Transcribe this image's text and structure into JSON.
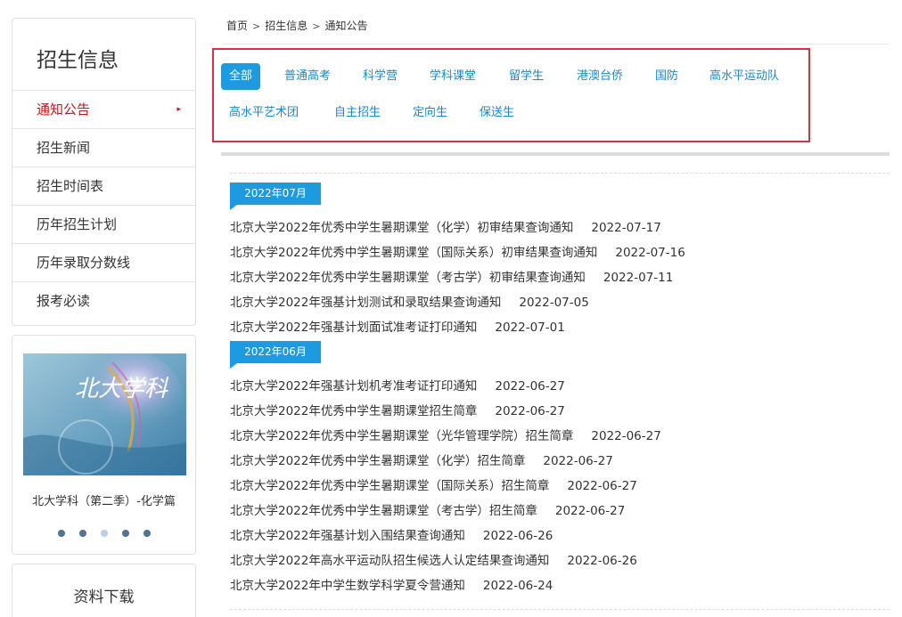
{
  "sidebar": {
    "title": "招生信息",
    "items": [
      {
        "label": "通知公告",
        "active": true
      },
      {
        "label": "招生新闻"
      },
      {
        "label": "招生时间表"
      },
      {
        "label": "历年招生计划"
      },
      {
        "label": "历年录取分数线"
      },
      {
        "label": "报考必读"
      }
    ],
    "caret": "▸"
  },
  "promo": {
    "caption": "北大学科（第二季）-化学篇",
    "image_text": "北大学科",
    "slide_count": 5,
    "active_slide": 2
  },
  "download": {
    "title": "资料下载"
  },
  "breadcrumb": {
    "items": [
      "首页",
      "招生信息",
      "通知公告"
    ],
    "separator": ">"
  },
  "filters": [
    {
      "label": "全部",
      "active": true
    },
    {
      "label": "普通高考"
    },
    {
      "label": "科学营"
    },
    {
      "label": "学科课堂"
    },
    {
      "label": "留学生"
    },
    {
      "label": "港澳台侨"
    },
    {
      "label": "国防"
    },
    {
      "label": "高水平运动队"
    },
    {
      "label": "高水平艺术团"
    },
    {
      "label": "自主招生"
    },
    {
      "label": "定向生"
    },
    {
      "label": "保送生"
    }
  ],
  "groups": [
    {
      "month": "2022年07月",
      "items": [
        {
          "title": "北京大学2022年优秀中学生暑期课堂（化学）初审结果查询通知",
          "date": "2022-07-17"
        },
        {
          "title": "北京大学2022年优秀中学生暑期课堂（国际关系）初审结果查询通知",
          "date": "2022-07-16"
        },
        {
          "title": "北京大学2022年优秀中学生暑期课堂（考古学）初审结果查询通知",
          "date": "2022-07-11"
        },
        {
          "title": "北京大学2022年强基计划测试和录取结果查询通知",
          "date": "2022-07-05"
        },
        {
          "title": "北京大学2022年强基计划面试准考证打印通知",
          "date": "2022-07-01"
        }
      ]
    },
    {
      "month": "2022年06月",
      "items": [
        {
          "title": "北京大学2022年强基计划机考准考证打印通知",
          "date": "2022-06-27"
        },
        {
          "title": "北京大学2022年优秀中学生暑期课堂招生简章",
          "date": "2022-06-27"
        },
        {
          "title": "北京大学2022年优秀中学生暑期课堂（光华管理学院）招生简章",
          "date": "2022-06-27"
        },
        {
          "title": "北京大学2022年优秀中学生暑期课堂（化学）招生简章",
          "date": "2022-06-27"
        },
        {
          "title": "北京大学2022年优秀中学生暑期课堂（国际关系）招生简章",
          "date": "2022-06-27"
        },
        {
          "title": "北京大学2022年优秀中学生暑期课堂（考古学）招生简章",
          "date": "2022-06-27"
        },
        {
          "title": "北京大学2022年强基计划入围结果查询通知",
          "date": "2022-06-26"
        },
        {
          "title": "北京大学2022年高水平运动队招生候选人认定结果查询通知",
          "date": "2022-06-26"
        },
        {
          "title": "北京大学2022年中学生数学科学夏令营通知",
          "date": "2022-06-24"
        }
      ]
    }
  ],
  "colors": {
    "accent": "#1e9ae0",
    "link": "#1a88c9",
    "active_menu": "#c4161c",
    "highlight_border": "#dc2f3b"
  }
}
